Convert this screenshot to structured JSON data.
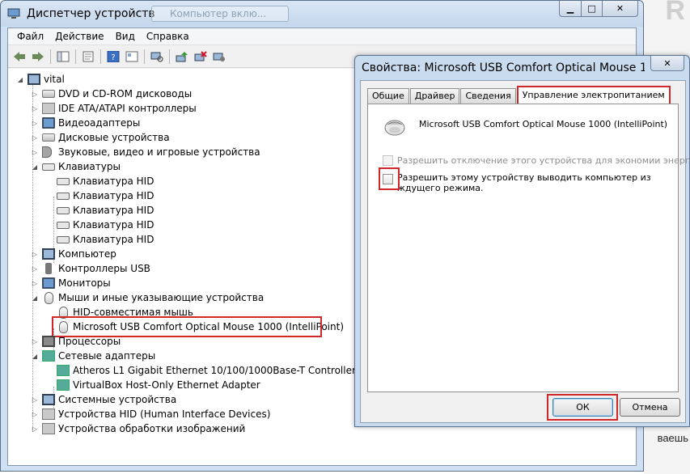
{
  "background": {
    "big_letter": "R",
    "tail_text": "ваешь"
  },
  "window": {
    "title": "Диспетчер устройств",
    "ghost_tab": "Компьютер вклю...",
    "caption": {
      "minimize": "▁",
      "maximize": "□",
      "close": "✕"
    }
  },
  "menu": [
    "Файл",
    "Действие",
    "Вид",
    "Справка"
  ],
  "toolbar_icons": [
    "back-arrow-icon",
    "forward-arrow-icon",
    "show-hide-tree-icon",
    "properties-icon",
    "help-icon",
    "view-icon",
    "scan-hardware-icon",
    "update-driver-icon",
    "uninstall-icon",
    "disable-icon"
  ],
  "tree": {
    "root": "vital",
    "items": [
      "DVD и CD-ROM дисководы",
      "IDE ATA/ATAPI контроллеры",
      "Видеоадаптеры",
      "Дисковые устройства",
      "Звуковые, видео и игровые устройства",
      "Клавиатуры",
      "Клавиатура HID",
      "Клавиатура HID",
      "Клавиатура HID",
      "Клавиатура HID",
      "Клавиатура HID",
      "Компьютер",
      "Контроллеры USB",
      "Мониторы",
      "Мыши и иные указывающие устройства",
      "HID-совместимая мышь",
      "Microsoft USB Comfort Optical Mouse 1000 (IntelliPoint)",
      "Процессоры",
      "Сетевые адаптеры",
      "Atheros L1 Gigabit Ethernet 10/100/1000Base-T Controller",
      "VirtualBox Host-Only Ethernet Adapter",
      "Системные устройства",
      "Устройства HID (Human Interface Devices)",
      "Устройства обработки изображений"
    ]
  },
  "dialog": {
    "title": "Свойства: Microsoft USB Comfort Optical Mouse 1...",
    "close": "✕",
    "tabs": [
      "Общие",
      "Драйвер",
      "Сведения",
      "Управление электропитанием"
    ],
    "device_name": "Microsoft USB Comfort Optical Mouse 1000 (IntelliPoint)",
    "option_disable_power": "Разрешить отключение этого устройства для экономии энергии.",
    "option_wake": "Разрешить этому устройству выводить компьютер из ждущего режима.",
    "ok": "ОК",
    "cancel": "Отмена"
  },
  "colors": {
    "highlight": "#d1262a",
    "frame": "#cfe0f2"
  }
}
